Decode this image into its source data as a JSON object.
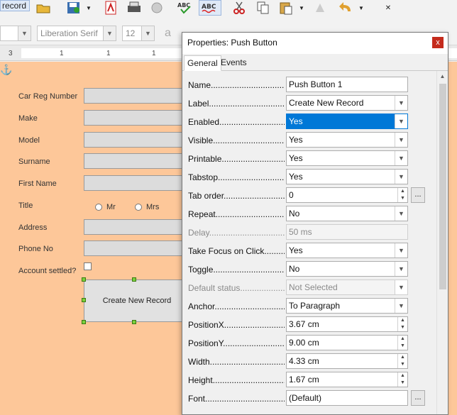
{
  "toolbar": {
    "record_label": "record",
    "font_name": "Liberation Serif",
    "font_size": "12",
    "icons": [
      "open-icon",
      "save-icon",
      "export-pdf-icon",
      "print-icon",
      "spellcheck-icon",
      "autospell-icon",
      "cut-icon",
      "copy-icon",
      "paste-icon",
      "clone-icon",
      "undo-icon"
    ]
  },
  "ruler": {
    "ticks": [
      "3",
      "1",
      "1",
      "1"
    ]
  },
  "form": {
    "fields": [
      {
        "label": "Car Reg Number"
      },
      {
        "label": "Make"
      },
      {
        "label": "Model"
      },
      {
        "label": "Surname"
      },
      {
        "label": "First Name"
      }
    ],
    "title_label": "Title",
    "radio_mr": "Mr",
    "radio_mrs": "Mrs",
    "address_label": "Address",
    "phone_label": "Phone No",
    "account_label": "Account settled?",
    "push_button": "Create New Record"
  },
  "dialog": {
    "title": "Properties: Push Button",
    "close": "x",
    "tabs": [
      "General",
      "Events"
    ],
    "active_tab": "General",
    "rows": [
      {
        "label": "Name.....................................",
        "value": "Push Button 1",
        "kind": "text"
      },
      {
        "label": "Label.......................................",
        "value": "Create New Record",
        "kind": "select"
      },
      {
        "label": "Enabled....................................",
        "value": "Yes",
        "kind": "select-highlight"
      },
      {
        "label": "Visible.......................................",
        "value": "Yes",
        "kind": "select"
      },
      {
        "label": "Printable...................................",
        "value": "Yes",
        "kind": "select"
      },
      {
        "label": "Tabstop.....................................",
        "value": "Yes",
        "kind": "select"
      },
      {
        "label": "Tab order..................................",
        "value": "0",
        "kind": "spin-ellipsis"
      },
      {
        "label": "Repeat.......................................",
        "value": "No",
        "kind": "select"
      },
      {
        "label": "Delay..........................................",
        "value": "50 ms",
        "kind": "text-disabled",
        "disabled": true
      },
      {
        "label": "Take Focus on Click..........",
        "value": "Yes",
        "kind": "select"
      },
      {
        "label": "Toggle.......................................",
        "value": "No",
        "kind": "select"
      },
      {
        "label": "Default status......................",
        "value": "Not Selected",
        "kind": "select-disabled",
        "disabled": true
      },
      {
        "label": "Anchor.......................................",
        "value": "To Paragraph",
        "kind": "select"
      },
      {
        "label": "PositionX...................................",
        "value": "3.67 cm",
        "kind": "spin"
      },
      {
        "label": "PositionY...................................",
        "value": "9.00 cm",
        "kind": "spin"
      },
      {
        "label": "Width...........................................",
        "value": "4.33 cm",
        "kind": "spin"
      },
      {
        "label": "Height.........................................",
        "value": "1.67 cm",
        "kind": "spin"
      },
      {
        "label": "Font.............................................",
        "value": "(Default)",
        "kind": "text-ellipsis"
      }
    ],
    "ellipsis": "..."
  },
  "colors": {
    "page_background": "#fdc799",
    "highlight": "#0078d7",
    "close_button": "#c42b1c"
  }
}
